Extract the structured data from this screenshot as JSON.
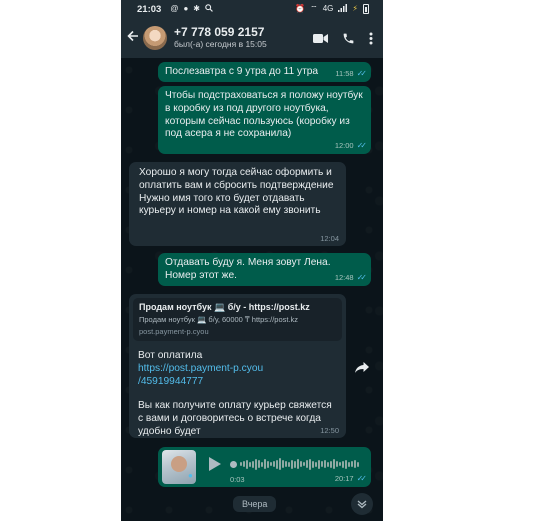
{
  "status_bar": {
    "time": "21:03",
    "network": "4G",
    "left_icons": [
      "at-icon",
      "github-icon",
      "sparkle-icon",
      "search-icon"
    ],
    "right_icons": [
      "alarm-icon",
      "wifi-hotspot-icon",
      "signal-icon",
      "battery-saver-icon",
      "battery-icon"
    ]
  },
  "header": {
    "contact_name": "+7 778 059 2157",
    "contact_status": "был(-а) сегодня в 15:05"
  },
  "messages": [
    {
      "id": "m1",
      "direction": "outgoing",
      "text": "Послезавтра с 9 утра до 11 утра",
      "time": "11:58",
      "read": true
    },
    {
      "id": "m2",
      "direction": "outgoing",
      "text": "Чтобы подстраховаться я положу ноутбук в коробку из под другого ноутбука, которым сейчас пользуюсь (коробку из под асера я не сохранила)",
      "time": "12:00",
      "read": true
    },
    {
      "id": "m3",
      "direction": "incoming",
      "text": "Хорошо я могу тогда сейчас оформить и оплатить вам и сбросить подтверждение\nНужно имя того кто будет отдавать курьеру и номер на какой ему звонить",
      "time": "12:04"
    },
    {
      "id": "m4",
      "direction": "outgoing",
      "text": "Отдавать буду я. Меня зовут Лена. Номер этот же.",
      "time": "12:48",
      "read": true
    },
    {
      "id": "m5",
      "direction": "incoming",
      "link_preview": {
        "title": "Продам ноутбук 💻 б/у - https://post.kz",
        "description": "Продам ноутбук 💻 б/у, 60000 ₸ https://post.kz",
        "domain": "post.payment-p.cyou"
      },
      "text_before_link": "Вот оплатила",
      "link": "https://post.payment-p.cyou\n/45919944777",
      "text_after_link": "Вы как получите оплату курьер свяжется с вами и договоритесь о встрече когда удобно будет",
      "time": "12:50"
    },
    {
      "id": "m6",
      "direction": "outgoing",
      "type": "voice",
      "duration": "0:03",
      "time": "20:17",
      "read": true
    }
  ],
  "date_separator": "Вчера",
  "colors": {
    "chat_bg": "#0b141a",
    "header_bg": "#1f2c34",
    "outgoing_bubble": "#005c4b",
    "incoming_bubble": "#1f2c34",
    "read_ticks": "#53bdeb",
    "link": "#53bdeb"
  }
}
